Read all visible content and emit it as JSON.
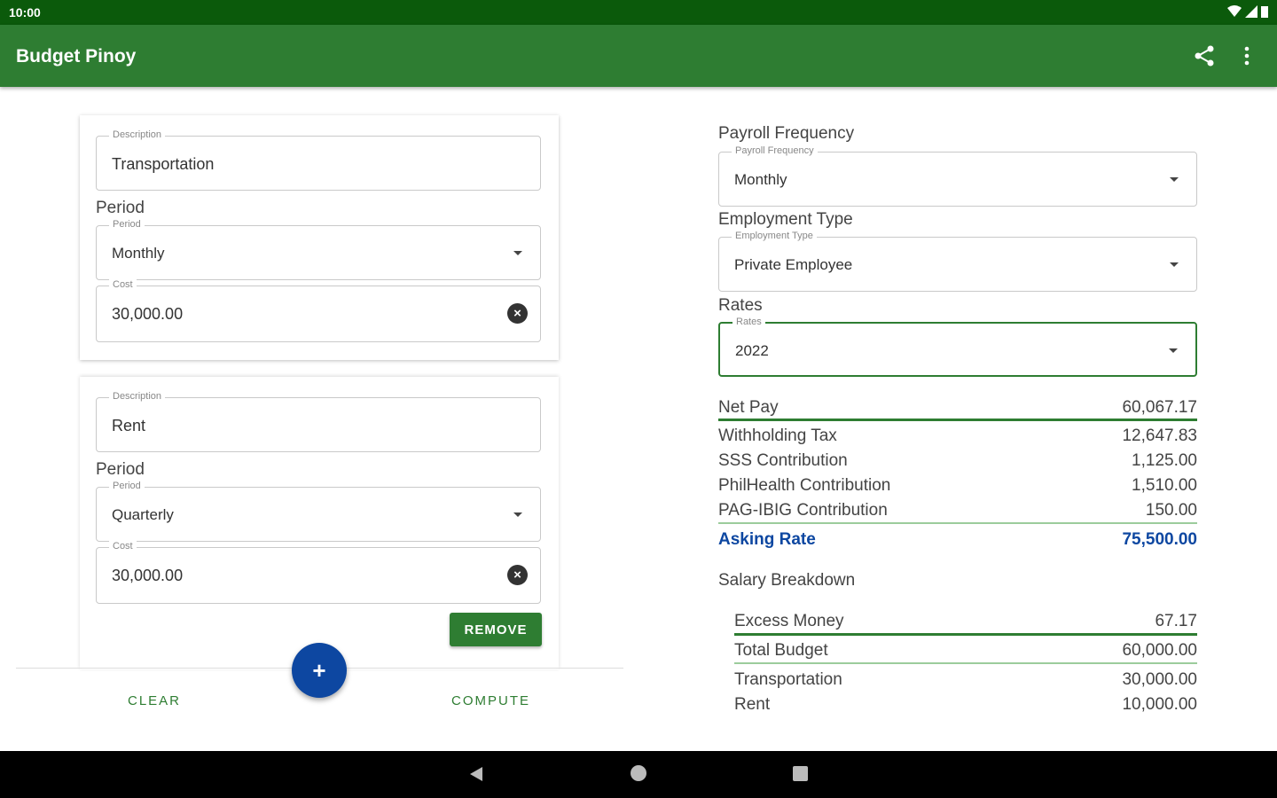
{
  "statusbar": {
    "time": "10:00"
  },
  "appbar": {
    "title": "Budget Pinoy",
    "actions": [
      "share-icon",
      "more-vert-icon"
    ]
  },
  "expenses": [
    {
      "description_label": "Description",
      "description": "Transportation",
      "period_heading": "Period",
      "period_label": "Period",
      "period": "Monthly",
      "cost_label": "Cost",
      "cost": "30,000.00"
    },
    {
      "description_label": "Description",
      "description": "Rent",
      "period_heading": "Period",
      "period_label": "Period",
      "period": "Quarterly",
      "cost_label": "Cost",
      "cost": "30,000.00",
      "remove_label": "REMOVE"
    }
  ],
  "actions": {
    "clear": "CLEAR",
    "add": "+",
    "compute": "COMPUTE"
  },
  "settings": {
    "payroll_heading": "Payroll Frequency",
    "payroll_label": "Payroll Frequency",
    "payroll": "Monthly",
    "employment_heading": "Employment Type",
    "employment_label": "Employment Type",
    "employment": "Private Employee",
    "rates_heading": "Rates",
    "rates_label": "Rates",
    "rates": "2022"
  },
  "summary": {
    "net_pay": {
      "label": "Net Pay",
      "value": "60,067.17"
    },
    "withholding": {
      "label": "Withholding Tax",
      "value": "12,647.83"
    },
    "sss": {
      "label": "SSS Contribution",
      "value": "1,125.00"
    },
    "philhealth": {
      "label": "PhilHealth Contribution",
      "value": "1,510.00"
    },
    "pagibig": {
      "label": "PAG-IBIG Contribution",
      "value": "150.00"
    },
    "asking": {
      "label": "Asking Rate",
      "value": "75,500.00"
    }
  },
  "breakdown": {
    "title": "Salary Breakdown",
    "excess": {
      "label": "Excess Money",
      "value": "67.17"
    },
    "total_budget": {
      "label": "Total Budget",
      "value": "60,000.00"
    },
    "items": [
      {
        "label": "Transportation",
        "value": "30,000.00"
      },
      {
        "label": "Rent",
        "value": "10,000.00"
      }
    ]
  },
  "colors": {
    "primary": "#2e7d32",
    "status": "#0b5a0b",
    "accent": "#0d47a1"
  }
}
